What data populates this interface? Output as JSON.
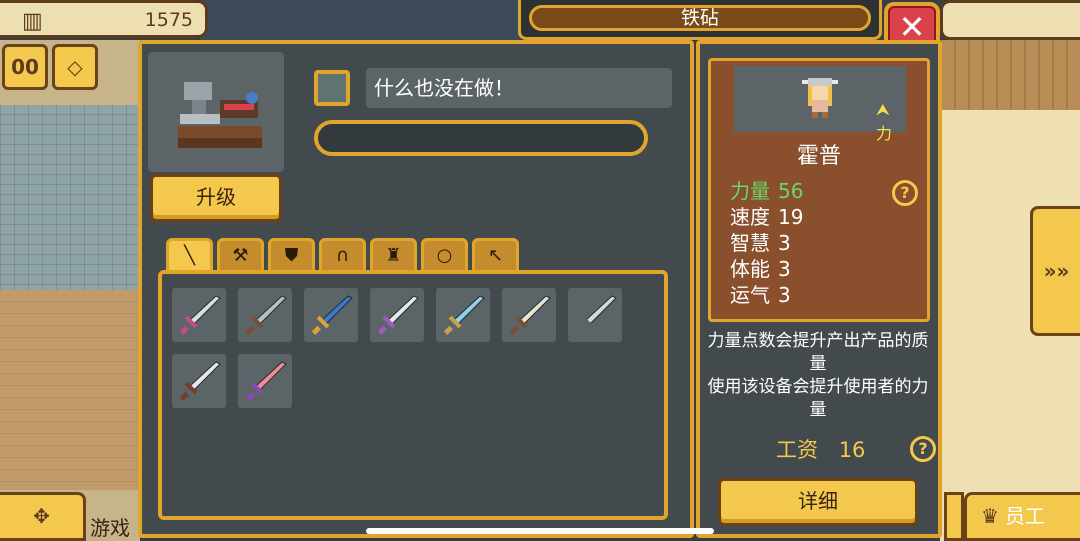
{
  "top": {
    "money_icon": "building-icon",
    "money": "1575",
    "pause_label": "00",
    "gems_label": "◇"
  },
  "title": "铁砧",
  "close_label": "✕",
  "machine": {
    "status": "什么也没在做！",
    "progress": 0,
    "upgrade_label": "升级"
  },
  "tabs": [
    {
      "icon": "sword-icon",
      "glyph": "╲",
      "active": true
    },
    {
      "icon": "axe-icon",
      "glyph": "⚒",
      "active": false
    },
    {
      "icon": "shield-icon",
      "glyph": "⛊",
      "active": false
    },
    {
      "icon": "helmet-icon",
      "glyph": "∩",
      "active": false
    },
    {
      "icon": "armor-icon",
      "glyph": "♜",
      "active": false
    },
    {
      "icon": "ring-icon",
      "glyph": "○",
      "active": false
    },
    {
      "icon": "pickaxe-icon",
      "glyph": "↖",
      "active": false
    }
  ],
  "items": [
    {
      "icon": "sword-icon",
      "blade": "#d7dde3",
      "hilt": "#c34b8b"
    },
    {
      "icon": "sword-icon",
      "blade": "#b9c1c7",
      "hilt": "#7a4e33"
    },
    {
      "icon": "sword-icon",
      "blade": "#3a78d1",
      "hilt": "#d8a23a"
    },
    {
      "icon": "sword-icon",
      "blade": "#e6e6ee",
      "hilt": "#a05ac8"
    },
    {
      "icon": "sword-icon",
      "blade": "#8fd2f0",
      "hilt": "#c9a04a"
    },
    {
      "icon": "sword-icon",
      "blade": "#e8e2d0",
      "hilt": "#7a4e33"
    },
    {
      "icon": "sword-icon",
      "blade": "#d4d9dc",
      "hilt": "#5f6266"
    },
    {
      "icon": "sword-icon",
      "blade": "#e8e8e8",
      "hilt": "#7a3d2a"
    },
    {
      "icon": "sword-icon",
      "blade": "#f08a9a",
      "hilt": "#8b4ab0"
    }
  ],
  "worker": {
    "name": "霍普",
    "tag": "力",
    "stats": [
      {
        "label": "力量",
        "value": "56",
        "highlight": true
      },
      {
        "label": "速度",
        "value": "19",
        "highlight": false
      },
      {
        "label": "智慧",
        "value": "3",
        "highlight": false
      },
      {
        "label": "体能",
        "value": "3",
        "highlight": false
      },
      {
        "label": "运气",
        "value": "3",
        "highlight": false
      }
    ],
    "help_label": "?",
    "description_1": "力量点数会提升产出产品的质量",
    "description_2": "使用该设备会提升使用者的力量",
    "wage_label": "工资",
    "wage_value": "16",
    "detail_label": "详细"
  },
  "side": {
    "next_label": "»»",
    "move_label": "✥",
    "game_text": "游戏",
    "staff_label": "员工",
    "staff_icon": "crown-icon"
  },
  "colors": {
    "gold": "#e1a52e",
    "button": "#f3c84c",
    "panel": "#434a4d",
    "close": "#d9424a",
    "card": "#8a4f2c",
    "highlight": "#6bd66b"
  }
}
